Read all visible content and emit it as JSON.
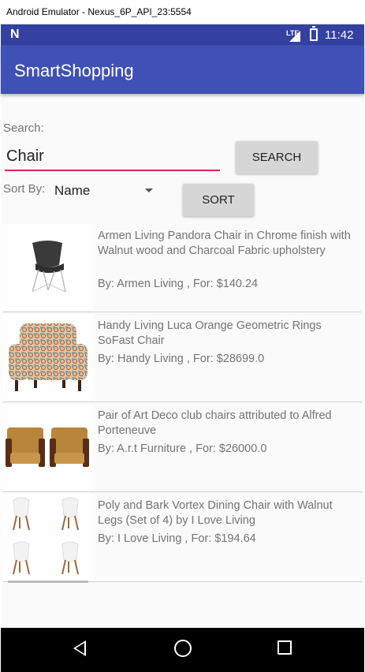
{
  "window": {
    "title": "Android Emulator - Nexus_6P_API_23:5554"
  },
  "status_bar": {
    "network": "LTE",
    "time": "11:42"
  },
  "app_bar": {
    "title": "SmartShopping"
  },
  "search": {
    "label": "Search:",
    "value": "Chair",
    "button": "SEARCH"
  },
  "sort": {
    "label": "Sort By:",
    "selected": "Name",
    "button": "SORT"
  },
  "products": [
    {
      "title": "Armen Living Pandora Chair in Chrome finish with Walnut wood and Charcoal Fabric upholstery",
      "meta": "By: Armen Living , For: $140.24"
    },
    {
      "title": "Handy Living Luca Orange Geometric Rings SoFast Chair",
      "meta": "By: Handy Living , For: $28699.0"
    },
    {
      "title": "Pair of Art Deco club chairs attributed to Alfred Porteneuve",
      "meta": "By: A.r.t Furniture , For: $26000.0"
    },
    {
      "title": "Poly and Bark Vortex Dining Chair with Walnut Legs (Set of 4) by I Love Living",
      "meta": "By: I Love Living , For: $194.64"
    }
  ],
  "colors": {
    "primary": "#3f51b5",
    "primary_dark": "#3441a0",
    "accent": "#e91e63"
  }
}
